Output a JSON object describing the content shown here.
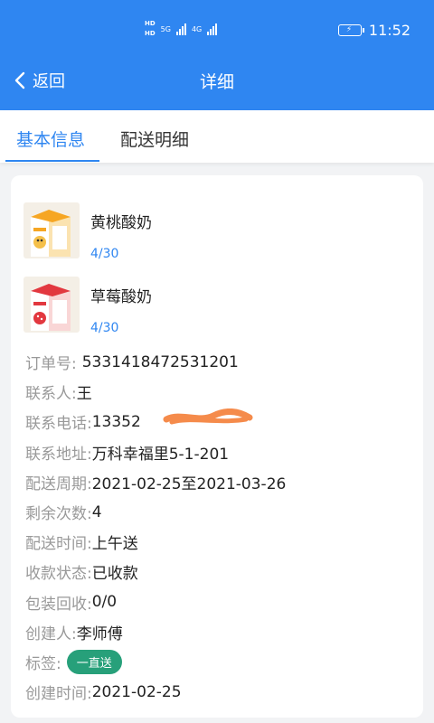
{
  "status_bar": {
    "hd1": "HD",
    "hd2": "HD",
    "net1": "5G",
    "net2": "4G",
    "time": "11:52"
  },
  "nav": {
    "back_label": "返回",
    "title": "详细"
  },
  "tabs": [
    {
      "label": "基本信息",
      "active": true
    },
    {
      "label": "配送明细",
      "active": false
    }
  ],
  "products": [
    {
      "name": "黄桃酸奶",
      "count": "4/30"
    },
    {
      "name": "草莓酸奶",
      "count": "4/30"
    }
  ],
  "details": {
    "order_no": {
      "label": "订单号:",
      "value": "5331418472531201"
    },
    "contact": {
      "label": "联系人:",
      "value": "王"
    },
    "phone": {
      "label": "联系电话:",
      "value": "13352"
    },
    "address": {
      "label": "联系地址:",
      "value": "万科幸福里5-1-201"
    },
    "period": {
      "label": "配送周期:",
      "value": "2021-02-25至2021-03-26"
    },
    "remaining": {
      "label": "剩余次数:",
      "value": "4"
    },
    "delivery_time": {
      "label": "配送时间:",
      "value": "上午送"
    },
    "payment": {
      "label": "收款状态:",
      "value": "已收款"
    },
    "recycle": {
      "label": "包装回收:",
      "value": "0/0"
    },
    "creator": {
      "label": "创建人:",
      "value": "李师傅"
    },
    "tag": {
      "label": "标签:",
      "value": "一直送"
    },
    "created": {
      "label": "创建时间:",
      "value": "2021-02-25"
    }
  },
  "colors": {
    "primary": "#2f86f1",
    "tag_bg": "#27a07a",
    "redact": "#f58b4b"
  }
}
